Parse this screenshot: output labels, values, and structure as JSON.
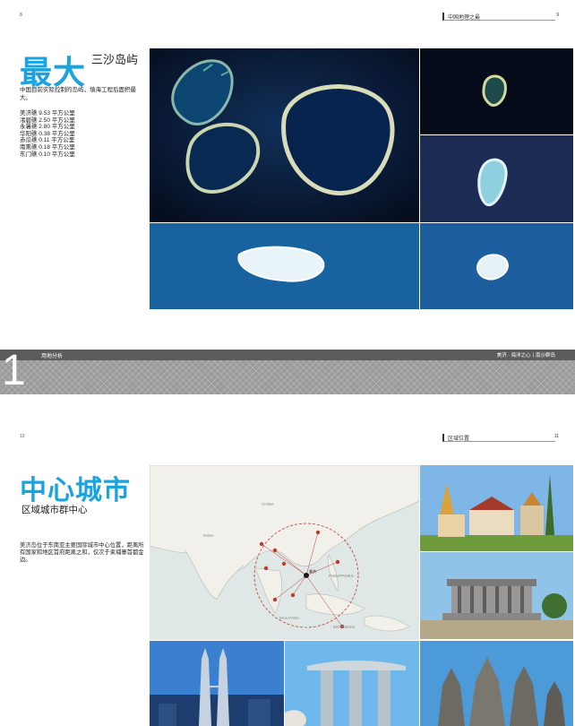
{
  "page1": {
    "page_number": "8",
    "header": {
      "title": "中国地理之最",
      "page_number": "9"
    },
    "title": "最大",
    "subtitle": "三沙岛屿",
    "intro": "中国目前实际控制的岛屿，填海工程后面积最大。",
    "stats": [
      "美济礁 9.53 平方公里",
      "渚碧礁 2.50 平方公里",
      "永暑礁 2.80 平方公里",
      "华阳礁 0.38 平方公里",
      "赤瓜礁 0.11 平方公里",
      "南熏礁 0.18 平方公里",
      "东门礁 0.10 平方公里"
    ],
    "footer": {
      "section_number": "1",
      "label": "用地分析",
      "right": "美济 · 海洋之心丨南沙群岛"
    },
    "colors": {
      "accent": "#1aa3de",
      "ocean_dark": "#0a1530",
      "ocean_light": "#1f6fb0"
    }
  },
  "page2": {
    "page_number": "10",
    "header": {
      "title": "区域位置",
      "page_number": "11"
    },
    "title": "中心城市",
    "subtitle": "区域城市群中心",
    "intro": "美济岛位于东南亚主要国际城市中心位置，距离所有国家和地区首府距离之和，仅次于柬埔寨首都金边。",
    "map_labels": [
      "CHINA",
      "INDIA",
      "PHILIPPINES",
      "MALAYSIA",
      "INDONESIA",
      "美济"
    ],
    "photos": [
      "grand-palace",
      "mausoleum",
      "petronas-towers",
      "marina-bay-sands",
      "angkor-wat"
    ]
  }
}
